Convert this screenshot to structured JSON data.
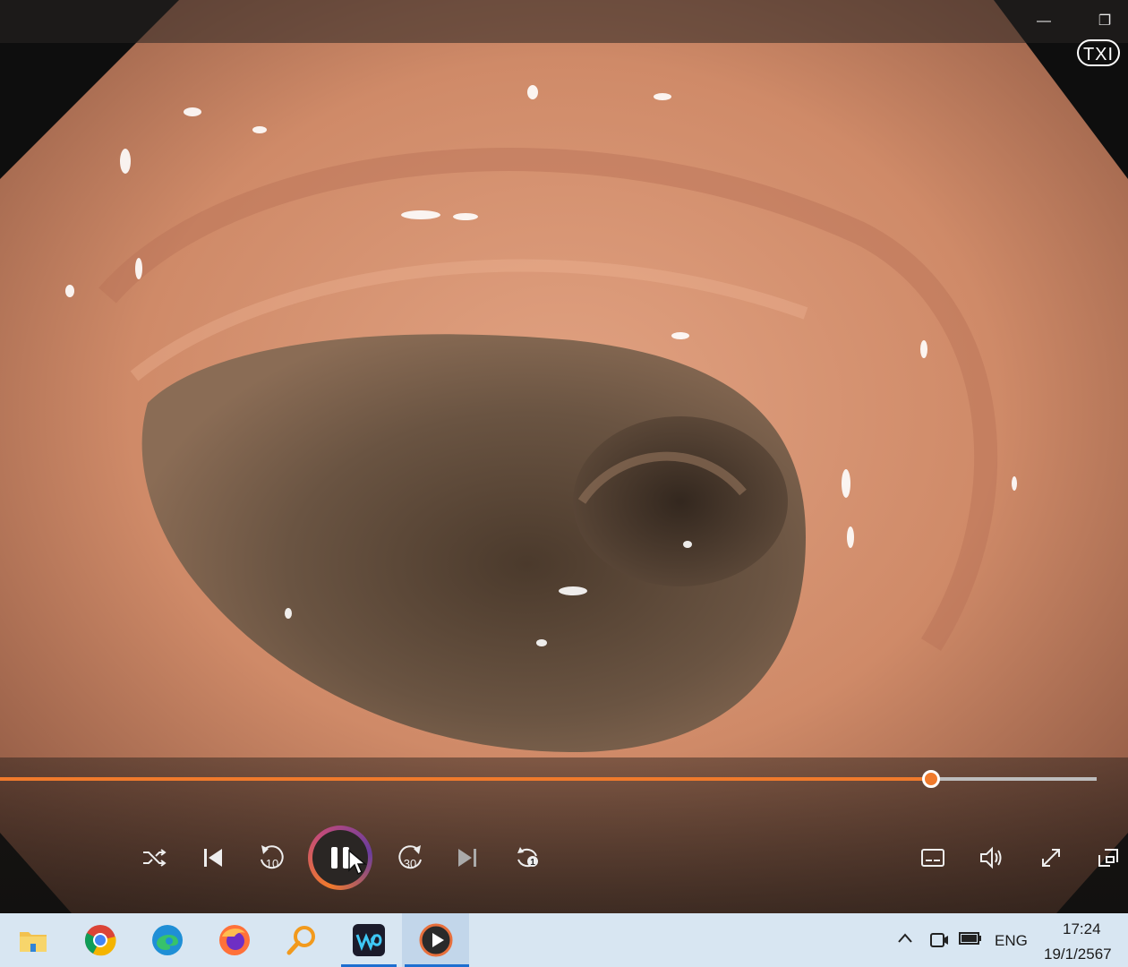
{
  "video": {
    "overlay_text": "TXI",
    "progress_fraction": 0.849
  },
  "window": {
    "minimize_glyph": "—",
    "restore_glyph": "❐"
  },
  "controls": {
    "shuffle_icon": "shuffle-icon",
    "previous_icon": "skip-previous-icon",
    "rewind_label": "10",
    "play_state": "playing",
    "forward_label": "30",
    "next_icon": "skip-next-icon",
    "repeat_label": "1",
    "captions_icon": "captions-icon",
    "volume_icon": "volume-icon",
    "fullscreen_icon": "fullscreen-icon",
    "miniplayer_icon": "mini-player-icon"
  },
  "taskbar": {
    "apps": [
      {
        "name": "file-explorer-icon",
        "active": false
      },
      {
        "name": "chrome-icon",
        "active": false
      },
      {
        "name": "edge-icon",
        "active": false
      },
      {
        "name": "firefox-icon",
        "active": false
      },
      {
        "name": "search-app-icon",
        "active": false
      },
      {
        "name": "webex-icon",
        "active": true
      },
      {
        "name": "media-player-icon",
        "active": true
      }
    ],
    "tray": {
      "language": "ENG",
      "time": "17:24",
      "date": "19/1/2567"
    }
  },
  "colors": {
    "accent": "#f07a2c",
    "taskbar": "#d8e6f2"
  }
}
